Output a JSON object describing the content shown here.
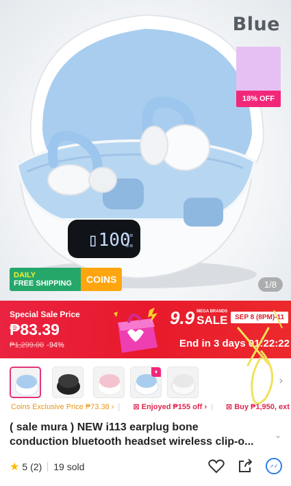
{
  "hero": {
    "color_label": "Blue",
    "discount_card": "18% OFF",
    "shipping_badge": {
      "line1": "DAILY",
      "line2": "FREE SHIPPING",
      "coins": "COINS"
    },
    "image_counter": "1/8",
    "case_display": "100"
  },
  "sale": {
    "label": "Special Sale Price",
    "price": "₱83.39",
    "original_price": "₱1,299.00",
    "discount_pct": "-94%",
    "event_main": "9.9",
    "event_small": "MEGA BRANDS",
    "event_sale": "SALE",
    "date_pill": "SEP 8 (8PM)-11",
    "ends_in": "End in 3 days 01:22:22"
  },
  "thumbnails": {
    "count": 5,
    "selected_index": 0
  },
  "promos": {
    "coins": "Coins Exclusive Price ₱73.38",
    "enjoyed": "Enjoyed ₱155 off",
    "buy": "Buy ₱1,950, ext"
  },
  "product": {
    "title_line1": "( sale mura ) NEW  i113 earplug bone",
    "title_line2": "conduction bluetooth headset wireless clip-o..."
  },
  "rating": {
    "score": "5",
    "count": "(2)",
    "sold": "19 sold"
  },
  "colors": {
    "sale_red": "#e8192c",
    "accent_pink": "#f2277a",
    "coins_orange": "#ffa50f",
    "shipping_green": "#25a76a",
    "star": "#ffb800"
  }
}
